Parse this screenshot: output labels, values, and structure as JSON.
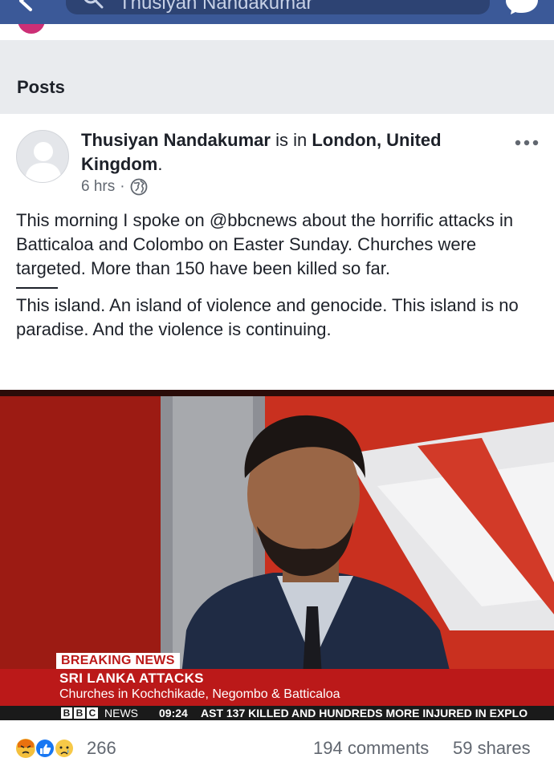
{
  "topbar": {
    "search_text": "Thusiyan Nandakumar",
    "colors": {
      "bar": "#3b5998",
      "search": "#2d4373"
    },
    "icons": [
      "back-arrow-icon",
      "search-icon",
      "messenger-icon"
    ]
  },
  "posts_section": {
    "title": "Posts"
  },
  "post": {
    "author": "Thusiyan Nandakumar",
    "location_connector": " is in ",
    "location": "London, United Kingdom",
    "location_end": ".",
    "time": "6 hrs",
    "separator": "·",
    "privacy_icon": "globe-icon",
    "paragraph_1": "This morning I spoke on @bbcnews about the horrific attacks in Batticaloa and Colombo on Easter Sunday. Churches were targeted. More than 150 have been killed so far.",
    "paragraph_2": "This island. An island of violence and genocide. This island is no paradise. And the violence is continuing."
  },
  "photo": {
    "breaking_label": "BREAKING NEWS",
    "headline": "SRI LANKA ATTACKS",
    "subheadline": "Churches in Kochchikade, Negombo & Batticaloa",
    "logo_letters": [
      "B",
      "B",
      "C"
    ],
    "channel": "NEWS",
    "time": "09:24",
    "crawl": "AST 137 KILLED AND HUNDREDS MORE INJURED IN EXPLO",
    "colors": {
      "band": "#bb1919",
      "strip": "#1a1a1a"
    }
  },
  "stats": {
    "reactions": [
      "angry-icon",
      "like-icon",
      "sad-icon"
    ],
    "reaction_count": "266",
    "comments": "194 comments",
    "shares": "59 shares"
  }
}
